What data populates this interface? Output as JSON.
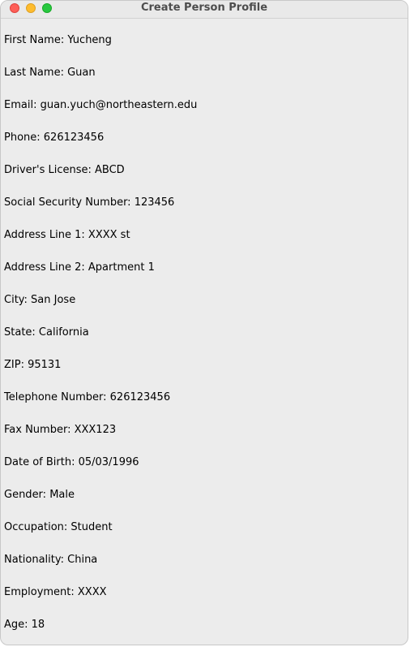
{
  "window": {
    "title": "Create Person Profile"
  },
  "profile": {
    "fields": [
      "First Name: Yucheng",
      "Last Name: Guan",
      "Email: guan.yuch@northeastern.edu",
      "Phone: 626123456",
      "Driver's License: ABCD",
      "Social Security Number: 123456",
      "Address Line 1: XXXX st",
      "Address Line 2: Apartment 1",
      "City: San Jose",
      "State: California",
      "ZIP: 95131",
      "Telephone Number: 626123456",
      "Fax Number: XXX123",
      "Date of Birth: 05/03/1996",
      "Gender: Male",
      "Occupation: Student",
      "Nationality: China",
      "Employment: XXXX",
      "Age: 18"
    ]
  },
  "colors": {
    "close": "#fe5f57",
    "minimize": "#febc2e",
    "zoom": "#28c840",
    "background": "#ececec"
  }
}
